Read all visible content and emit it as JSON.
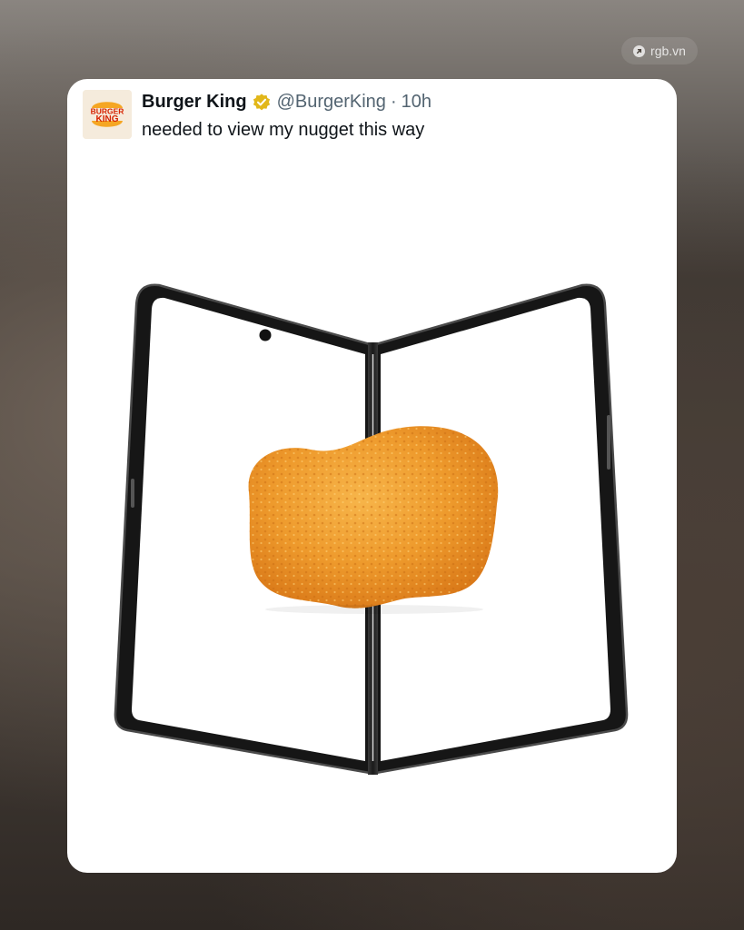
{
  "watermark": {
    "text": "rgb.vn",
    "icon": "arrow-up-right-icon"
  },
  "tweet": {
    "display_name": "Burger King",
    "verified_badge": "verified-badge-icon",
    "handle": "@BurgerKing",
    "separator": "·",
    "time": "10h",
    "text": "needed to view my nugget this way",
    "avatar_logo": {
      "line1": "BURGER",
      "line2": "KING"
    }
  },
  "colors": {
    "brand_red": "#d62300",
    "brand_orange": "#f5a623",
    "verified_gold": "#e2b719",
    "text_primary": "#0f1419",
    "text_secondary": "#536471"
  }
}
